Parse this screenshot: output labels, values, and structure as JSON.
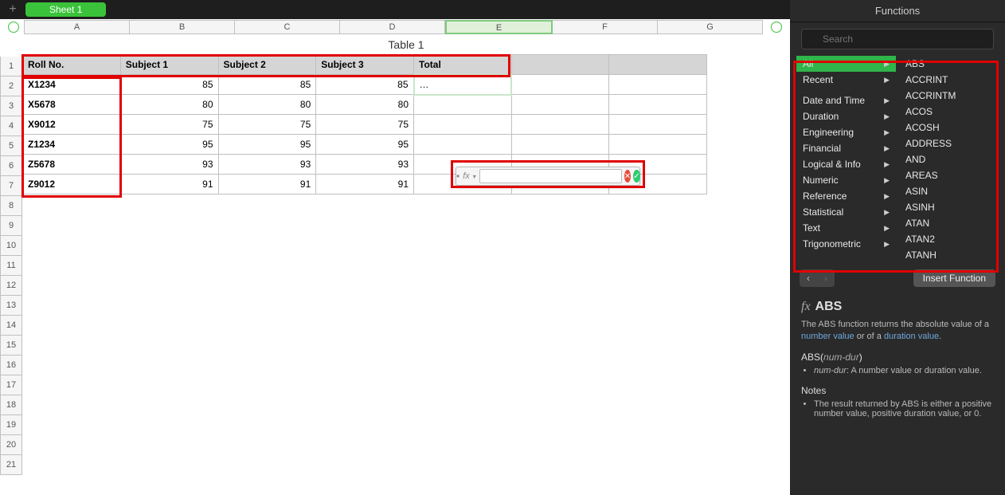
{
  "tabs": {
    "add": "+",
    "sheet1": "Sheet 1"
  },
  "columns": [
    "A",
    "B",
    "C",
    "D",
    "E",
    "F",
    "G"
  ],
  "rows_count": 21,
  "table": {
    "title": "Table 1",
    "headers": [
      "Roll No.",
      "Subject 1",
      "Subject 2",
      "Subject 3",
      "Total",
      "",
      ""
    ],
    "data": [
      {
        "roll": "X1234",
        "s1": 85,
        "s2": 85,
        "s3": 85,
        "total": "…"
      },
      {
        "roll": "X5678",
        "s1": 80,
        "s2": 80,
        "s3": 80,
        "total": ""
      },
      {
        "roll": "X9012",
        "s1": 75,
        "s2": 75,
        "s3": 75,
        "total": ""
      },
      {
        "roll": "Z1234",
        "s1": 95,
        "s2": 95,
        "s3": 95,
        "total": ""
      },
      {
        "roll": "Z5678",
        "s1": 93,
        "s2": 93,
        "s3": 93,
        "total": ""
      },
      {
        "roll": "Z9012",
        "s1": 91,
        "s2": 91,
        "s3": 91,
        "total": ""
      }
    ]
  },
  "formula_popup": {
    "fx": "fx",
    "input": ""
  },
  "side": {
    "title": "Functions",
    "search_placeholder": "Search",
    "categories": [
      "All",
      "Recent",
      "",
      "Date and Time",
      "Duration",
      "Engineering",
      "Financial",
      "Logical & Info",
      "Numeric",
      "Reference",
      "Statistical",
      "Text",
      "Trigonometric"
    ],
    "functions": [
      "ABS",
      "ACCRINT",
      "ACCRINTM",
      "ACOS",
      "ACOSH",
      "ADDRESS",
      "AND",
      "AREAS",
      "ASIN",
      "ASINH",
      "ATAN",
      "ATAN2",
      "ATANH"
    ],
    "insert_label": "Insert Function",
    "detail": {
      "name": "ABS",
      "desc_pre": "The ABS function returns the absolute value of a ",
      "link1": "number value",
      "desc_mid": " or of a ",
      "link2": "duration value",
      "desc_end": ".",
      "sig_name": "ABS",
      "sig_arg": "num-dur",
      "arg_name": "num-dur",
      "arg_desc": ": A number value or duration value.",
      "notes_h": "Notes",
      "note1": "The result returned by ABS is either a positive number value, positive duration value, or 0."
    }
  }
}
